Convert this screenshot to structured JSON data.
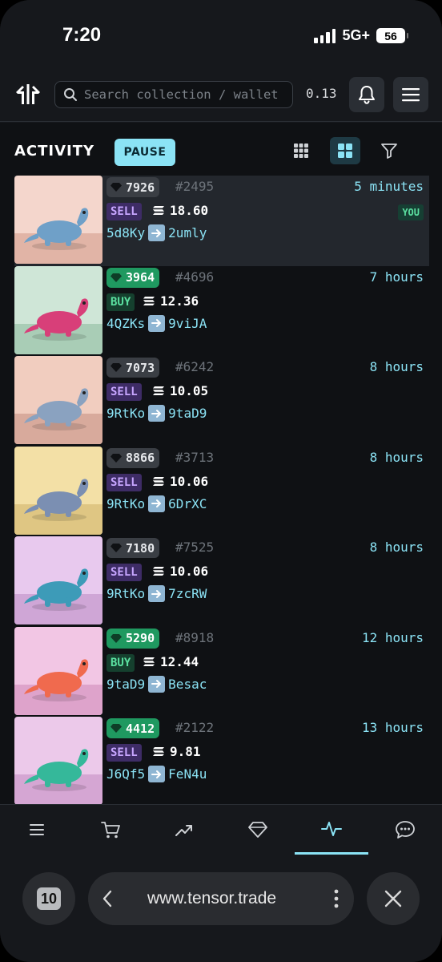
{
  "status_bar": {
    "time": "7:20",
    "network": "5G+",
    "battery": "56"
  },
  "header": {
    "logo_icon": "tensor-logo-icon",
    "search_placeholder": "Search collection / wallet",
    "sol_price": "0.13"
  },
  "activity": {
    "title": "ACTIVITY",
    "pause_label": "PAUSE",
    "accent_color": "#8be3f5"
  },
  "rows": [
    {
      "rank": "7926",
      "rank_style": "gray",
      "mint": "#2495",
      "time": "5 minutes",
      "type": "SELL",
      "price": "18.60",
      "from": "5d8Ky",
      "to": "2umly",
      "badge": "YOU",
      "colors": [
        "#f4d6cc",
        "#e1b4a6",
        "#6fa0c8"
      ]
    },
    {
      "rank": "3964",
      "rank_style": "green",
      "mint": "#4696",
      "time": "7 hours",
      "type": "BUY",
      "price": "12.36",
      "from": "4QZKs",
      "to": "9viJA",
      "colors": [
        "#cfe6d7",
        "#a9cdb6",
        "#d83f79"
      ]
    },
    {
      "rank": "7073",
      "rank_style": "gray",
      "mint": "#6242",
      "time": "8 hours",
      "type": "SELL",
      "price": "10.05",
      "from": "9RtKo",
      "to": "9taD9",
      "colors": [
        "#f1cdbf",
        "#d8aa9c",
        "#8aa2c0"
      ]
    },
    {
      "rank": "8866",
      "rank_style": "gray",
      "mint": "#3713",
      "time": "8 hours",
      "type": "SELL",
      "price": "10.06",
      "from": "9RtKo",
      "to": "6DrXC",
      "colors": [
        "#f3e0a6",
        "#dfc683",
        "#7b8fb2"
      ]
    },
    {
      "rank": "7180",
      "rank_style": "gray",
      "mint": "#7525",
      "time": "8 hours",
      "type": "SELL",
      "price": "10.06",
      "from": "9RtKo",
      "to": "7zcRW",
      "colors": [
        "#e8c9ee",
        "#cfa6d6",
        "#3d9bb8"
      ]
    },
    {
      "rank": "5290",
      "rank_style": "green",
      "mint": "#8918",
      "time": "12 hours",
      "type": "BUY",
      "price": "12.44",
      "from": "9taD9",
      "to": "Besac",
      "colors": [
        "#f2c6e4",
        "#dea3cb",
        "#f06a4e"
      ]
    },
    {
      "rank": "4412",
      "rank_style": "green",
      "mint": "#2122",
      "time": "13 hours",
      "type": "SELL",
      "price": "9.81",
      "from": "J6Qf5",
      "to": "FeN4u",
      "colors": [
        "#ecc9ea",
        "#d5a6d3",
        "#35b89a"
      ]
    }
  ],
  "browser": {
    "tabs_count": "10",
    "url": "www.tensor.trade"
  }
}
